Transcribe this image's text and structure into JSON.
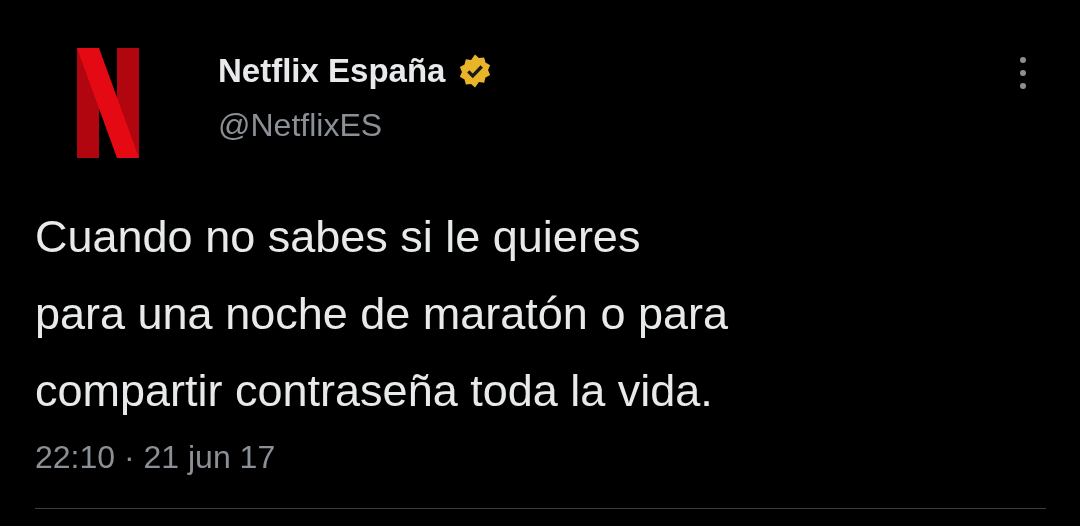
{
  "tweet": {
    "author": {
      "name": "Netflix España",
      "verified": true,
      "handle": "@NetflixES"
    },
    "text": "Cuando no sabes si le quieres\npara una noche de maratón o para\ncompartir contraseña toda la vida.",
    "timestamp": "22:10 · 21 jun 17"
  }
}
